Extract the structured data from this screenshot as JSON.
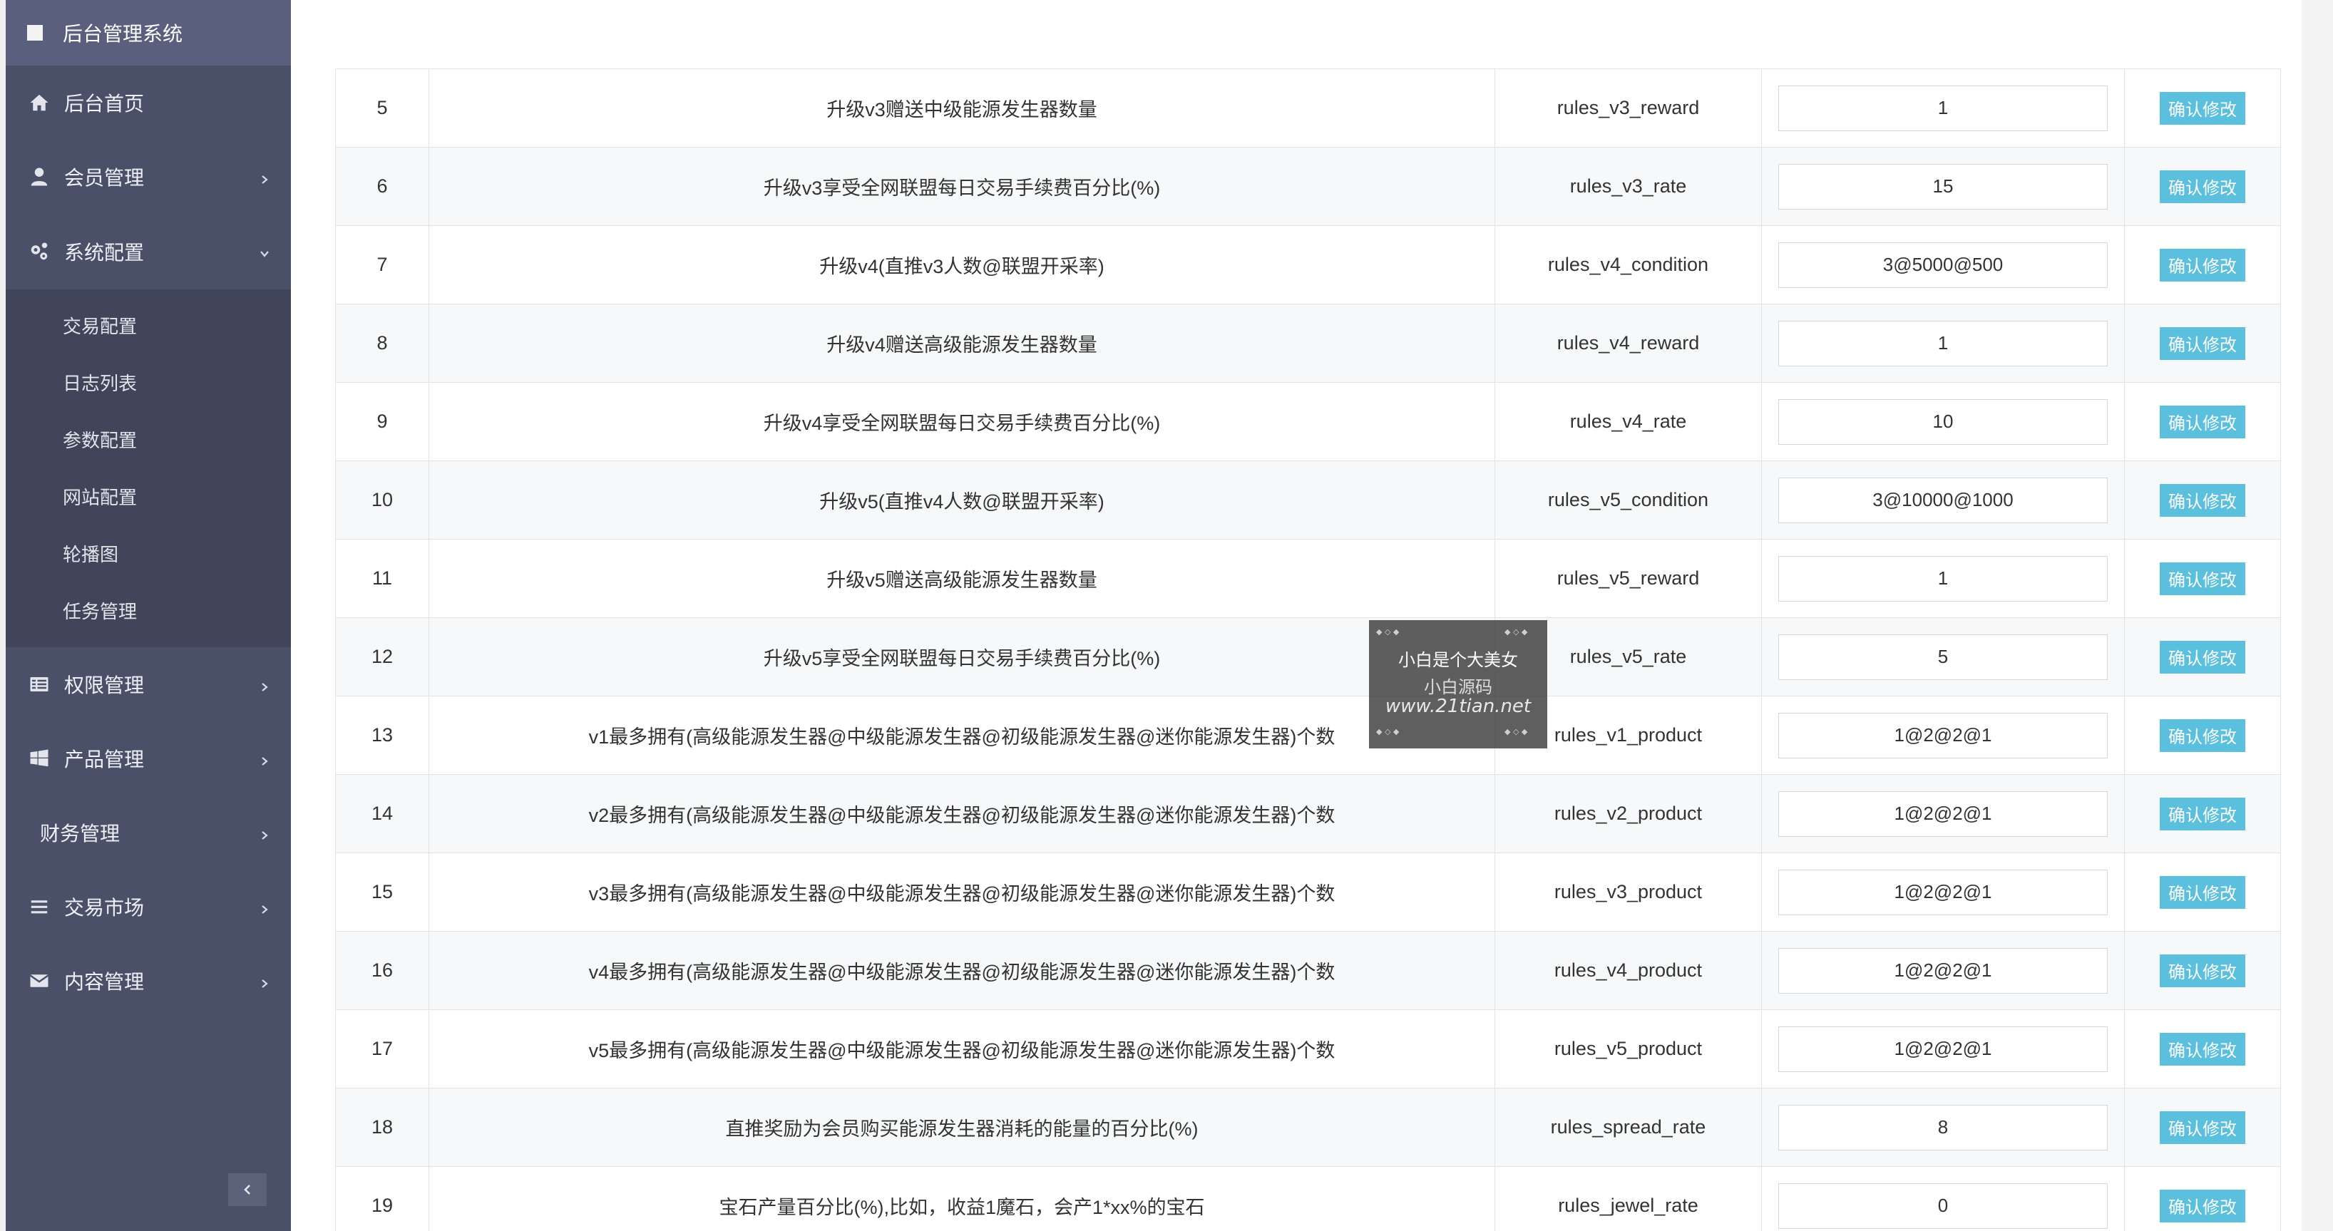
{
  "sidebar": {
    "brand": "后台管理系统",
    "items": [
      {
        "label": "后台首页"
      },
      {
        "label": "会员管理"
      },
      {
        "label": "系统配置"
      },
      {
        "label": "权限管理"
      },
      {
        "label": "产品管理"
      },
      {
        "label": "财务管理"
      },
      {
        "label": "交易市场"
      },
      {
        "label": "内容管理"
      }
    ],
    "submenu": [
      "交易配置",
      "日志列表",
      "参数配置",
      "网站配置",
      "轮播图",
      "任务管理"
    ]
  },
  "table": {
    "button_label": "确认修改",
    "rows": [
      {
        "id": "5",
        "desc": "升级v3赠送中级能源发生器数量",
        "key": "rules_v3_reward",
        "value": "1"
      },
      {
        "id": "6",
        "desc": "升级v3享受全网联盟每日交易手续费百分比(%)",
        "key": "rules_v3_rate",
        "value": "15"
      },
      {
        "id": "7",
        "desc": "升级v4(直推v3人数@联盟开采率)",
        "key": "rules_v4_condition",
        "value": "3@5000@500"
      },
      {
        "id": "8",
        "desc": "升级v4赠送高级能源发生器数量",
        "key": "rules_v4_reward",
        "value": "1"
      },
      {
        "id": "9",
        "desc": "升级v4享受全网联盟每日交易手续费百分比(%)",
        "key": "rules_v4_rate",
        "value": "10"
      },
      {
        "id": "10",
        "desc": "升级v5(直推v4人数@联盟开采率)",
        "key": "rules_v5_condition",
        "value": "3@10000@1000"
      },
      {
        "id": "11",
        "desc": "升级v5赠送高级能源发生器数量",
        "key": "rules_v5_reward",
        "value": "1"
      },
      {
        "id": "12",
        "desc": "升级v5享受全网联盟每日交易手续费百分比(%)",
        "key": "rules_v5_rate",
        "value": "5"
      },
      {
        "id": "13",
        "desc": "v1最多拥有(高级能源发生器@中级能源发生器@初级能源发生器@迷你能源发生器)个数",
        "key": "rules_v1_product",
        "value": "1@2@2@1"
      },
      {
        "id": "14",
        "desc": "v2最多拥有(高级能源发生器@中级能源发生器@初级能源发生器@迷你能源发生器)个数",
        "key": "rules_v2_product",
        "value": "1@2@2@1"
      },
      {
        "id": "15",
        "desc": "v3最多拥有(高级能源发生器@中级能源发生器@初级能源发生器@迷你能源发生器)个数",
        "key": "rules_v3_product",
        "value": "1@2@2@1"
      },
      {
        "id": "16",
        "desc": "v4最多拥有(高级能源发生器@中级能源发生器@初级能源发生器@迷你能源发生器)个数",
        "key": "rules_v4_product",
        "value": "1@2@2@1"
      },
      {
        "id": "17",
        "desc": "v5最多拥有(高级能源发生器@中级能源发生器@初级能源发生器@迷你能源发生器)个数",
        "key": "rules_v5_product",
        "value": "1@2@2@1"
      },
      {
        "id": "18",
        "desc": "直推奖励为会员购买能源发生器消耗的能量的百分比(%)",
        "key": "rules_spread_rate",
        "value": "8"
      },
      {
        "id": "19",
        "desc": "宝石产量百分比(%),比如，收益1魔石，会产1*xx%的宝石",
        "key": "rules_jewel_rate",
        "value": "0"
      }
    ]
  },
  "watermark": {
    "line1": "小白是个大美女",
    "line2": "小白源码",
    "line3": "www.21tian.net"
  }
}
